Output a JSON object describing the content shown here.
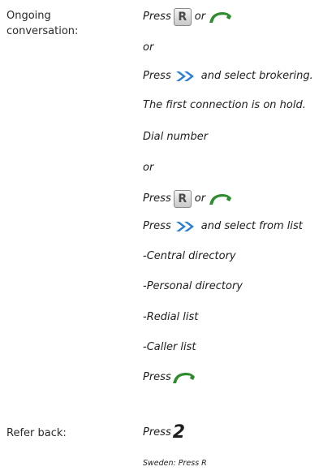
{
  "labels": {
    "ongoing_line1": "Ongoing",
    "ongoing_line2": "conversation:",
    "refer_back": "Refer back:"
  },
  "lines": {
    "press": "Press",
    "or": "or",
    "r_key": "R",
    "and_select_brokering": "and select brokering.",
    "first_connection_hold": "The first connection is on hold.",
    "dial_number": "Dial number",
    "and_select_from_list": "and select from list",
    "central_directory": "-Central directory",
    "personal_directory": "-Personal directory",
    "redial_list": "-Redial list",
    "caller_list": "-Caller list",
    "digit_2": "2"
  },
  "note": {
    "sweden": "Sweden: Press R"
  },
  "icons": {
    "phone": "phone-handset-green-icon",
    "chevron": "double-chevron-blue-icon",
    "r_key": "r-key-icon"
  },
  "colors": {
    "phone": "#2e8b2e",
    "chevron": "#2a7fd4"
  }
}
